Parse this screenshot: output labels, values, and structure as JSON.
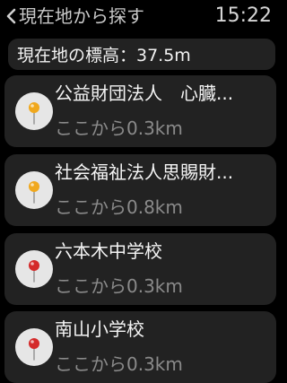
{
  "header": {
    "title": "現在地から探す",
    "time": "15:22",
    "back_icon": "chevron-left-icon"
  },
  "elevation": {
    "text": "現在地の標高：37.5m"
  },
  "results": [
    {
      "name": "公益財団法人　心臓...",
      "distance": "ここから0.3km",
      "pin_color": "#f0a81d",
      "icon": "map-pin-icon"
    },
    {
      "name": "社会福祉法人思賜財...",
      "distance": "ここから0.8km",
      "pin_color": "#f0a81d",
      "icon": "map-pin-icon"
    },
    {
      "name": "六本木中学校",
      "distance": "ここから0.3km",
      "pin_color": "#d42a2a",
      "icon": "map-pin-icon"
    },
    {
      "name": "南山小学校",
      "distance": "ここから0.3km",
      "pin_color": "#d42a2a",
      "icon": "map-pin-icon"
    }
  ]
}
